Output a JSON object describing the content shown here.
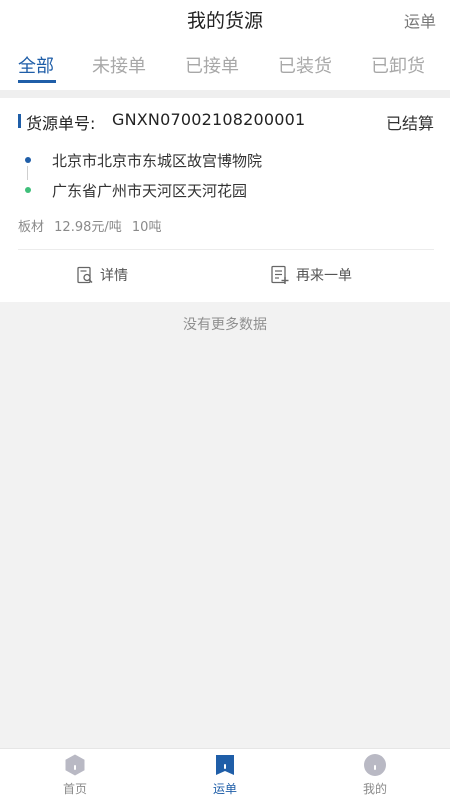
{
  "header": {
    "title": "我的货源",
    "right_link": "运单"
  },
  "tabs": [
    {
      "label": "全部",
      "active": true
    },
    {
      "label": "未接单",
      "active": false
    },
    {
      "label": "已接单",
      "active": false
    },
    {
      "label": "已装货",
      "active": false
    },
    {
      "label": "已卸货",
      "active": false
    }
  ],
  "order": {
    "label": "货源单号:",
    "number": "GNXN07002108200001",
    "status": "已结算",
    "from_address": "北京市北京市东城区故宫博物院",
    "to_address": "广东省广州市天河区天河花园",
    "cargo_name": "板材",
    "price": "12.98元/吨",
    "weight": "10吨",
    "actions": {
      "detail": "详情",
      "reorder": "再来一单"
    }
  },
  "list_footer": "没有更多数据",
  "bottom_nav": [
    {
      "label": "首页",
      "icon": "home-icon",
      "active": false
    },
    {
      "label": "运单",
      "icon": "waybill-icon",
      "active": true
    },
    {
      "label": "我的",
      "icon": "profile-icon",
      "active": false
    }
  ],
  "colors": {
    "accent": "#1f5ea8",
    "destination_dot": "#3fbf7a",
    "inactive_tab": "#a8a8a8",
    "inactive_nav_icon": "#b9b9c4"
  }
}
